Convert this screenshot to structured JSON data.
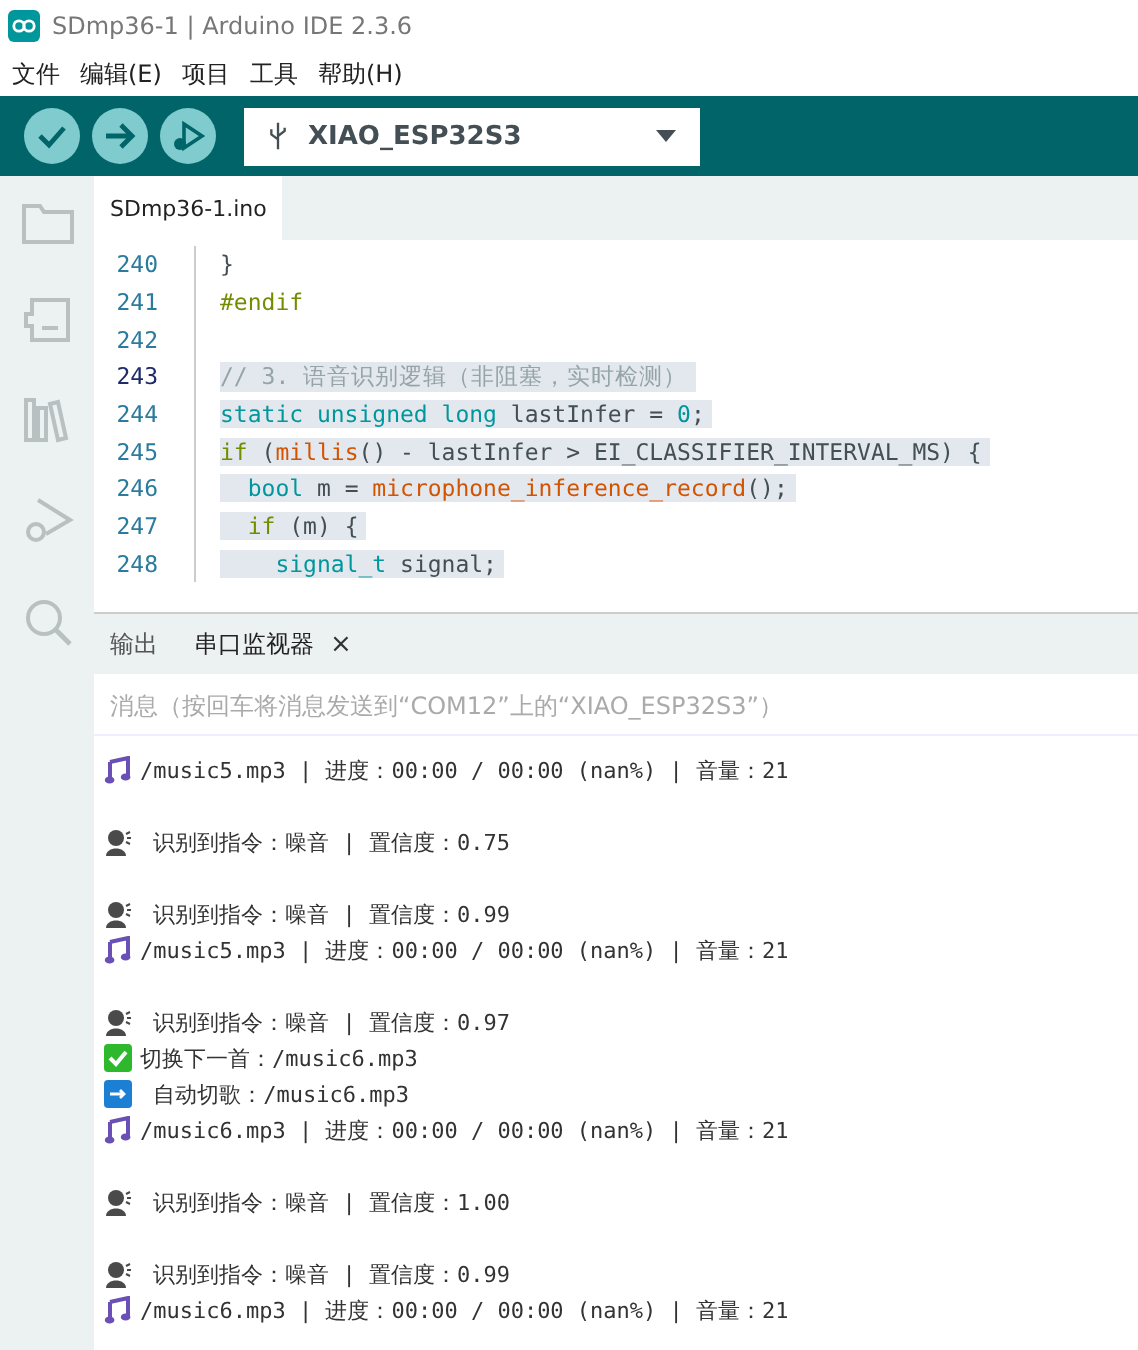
{
  "window": {
    "title": "SDmp36-1 | Arduino IDE 2.3.6"
  },
  "menu": [
    "文件",
    "编辑(E)",
    "项目",
    "工具",
    "帮助(H)"
  ],
  "toolbar": {
    "board": "XIAO_ESP32S3"
  },
  "editor": {
    "tabs": [
      {
        "label": "SDmp36-1.ino",
        "selected": true
      }
    ],
    "lines": [
      {
        "number": "240",
        "highlighted": false,
        "current": false,
        "tokens": [
          {
            "kind": "plain",
            "text": "}"
          }
        ]
      },
      {
        "number": "241",
        "highlighted": false,
        "current": false,
        "tokens": [
          {
            "kind": "control",
            "text": "#endif"
          }
        ]
      },
      {
        "number": "242",
        "highlighted": false,
        "current": false
      },
      {
        "number": "243",
        "highlighted": true,
        "current": true,
        "tokens": [
          {
            "kind": "comment",
            "text": "// 3. 语音识别逻辑（非阻塞，实时检测）"
          }
        ]
      },
      {
        "number": "244",
        "highlighted": true,
        "current": false,
        "tokens": [
          {
            "kind": "type",
            "text": "static unsigned long"
          },
          {
            "kind": "plain",
            "text": " lastInfer = "
          },
          {
            "kind": "type",
            "text": "0"
          },
          {
            "kind": "plain",
            "text": ";"
          }
        ]
      },
      {
        "number": "245",
        "highlighted": true,
        "current": false,
        "tokens": [
          {
            "kind": "control",
            "text": "if"
          },
          {
            "kind": "plain",
            "text": " ("
          },
          {
            "kind": "func",
            "text": "millis"
          },
          {
            "kind": "plain",
            "text": "() - lastInfer > EI_CLASSIFIER_INTERVAL_MS) {"
          }
        ]
      },
      {
        "number": "246",
        "highlighted": true,
        "current": false,
        "tokens": [
          {
            "kind": "type",
            "text": "  bool"
          },
          {
            "kind": "plain",
            "text": " m = "
          },
          {
            "kind": "func",
            "text": "microphone_inference_record"
          },
          {
            "kind": "plain",
            "text": "();"
          }
        ]
      },
      {
        "number": "247",
        "highlighted": true,
        "current": false,
        "tokens": [
          {
            "kind": "control",
            "text": "  if"
          },
          {
            "kind": "plain",
            "text": " (m) {"
          }
        ]
      },
      {
        "number": "248",
        "highlighted": true,
        "current": false,
        "tokens": [
          {
            "kind": "type",
            "text": "    signal_t"
          },
          {
            "kind": "plain",
            "text": " signal;"
          }
        ]
      }
    ]
  },
  "panel": {
    "tabs": [
      {
        "label": "输出",
        "selected": false,
        "closable": false
      },
      {
        "label": "串口监视器",
        "selected": true,
        "closable": true
      }
    ],
    "close_icon": "×",
    "message_field": {
      "placeholder": "消息（按回车将消息发送到“COM12”上的“XIAO_ESP32S3”）"
    },
    "log": [
      {
        "kind": "music",
        "text": "/music5.mp3 | 进度：00:00 / 00:00 (nan%) | 音量：21"
      },
      {
        "kind": "blank"
      },
      {
        "kind": "voice",
        "text": " 识别到指令：噪音 | 置信度：0.75"
      },
      {
        "kind": "blank"
      },
      {
        "kind": "voice",
        "text": " 识别到指令：噪音 | 置信度：0.99"
      },
      {
        "kind": "music",
        "text": "/music5.mp3 | 进度：00:00 / 00:00 (nan%) | 音量：21"
      },
      {
        "kind": "blank"
      },
      {
        "kind": "voice",
        "text": " 识别到指令：噪音 | 置信度：0.97"
      },
      {
        "kind": "check",
        "text": "切换下一首：/music6.mp3"
      },
      {
        "kind": "arrow",
        "text": " 自动切歌：/music6.mp3"
      },
      {
        "kind": "music",
        "text": "/music6.mp3 | 进度：00:00 / 00:00 (nan%) | 音量：21"
      },
      {
        "kind": "blank"
      },
      {
        "kind": "voice",
        "text": " 识别到指令：噪音 | 置信度：1.00"
      },
      {
        "kind": "blank"
      },
      {
        "kind": "voice",
        "text": " 识别到指令：噪音 | 置信度：0.99"
      },
      {
        "kind": "music",
        "text": "/music6.mp3 | 进度：00:00 / 00:00 (nan%) | 音量：21"
      }
    ]
  }
}
